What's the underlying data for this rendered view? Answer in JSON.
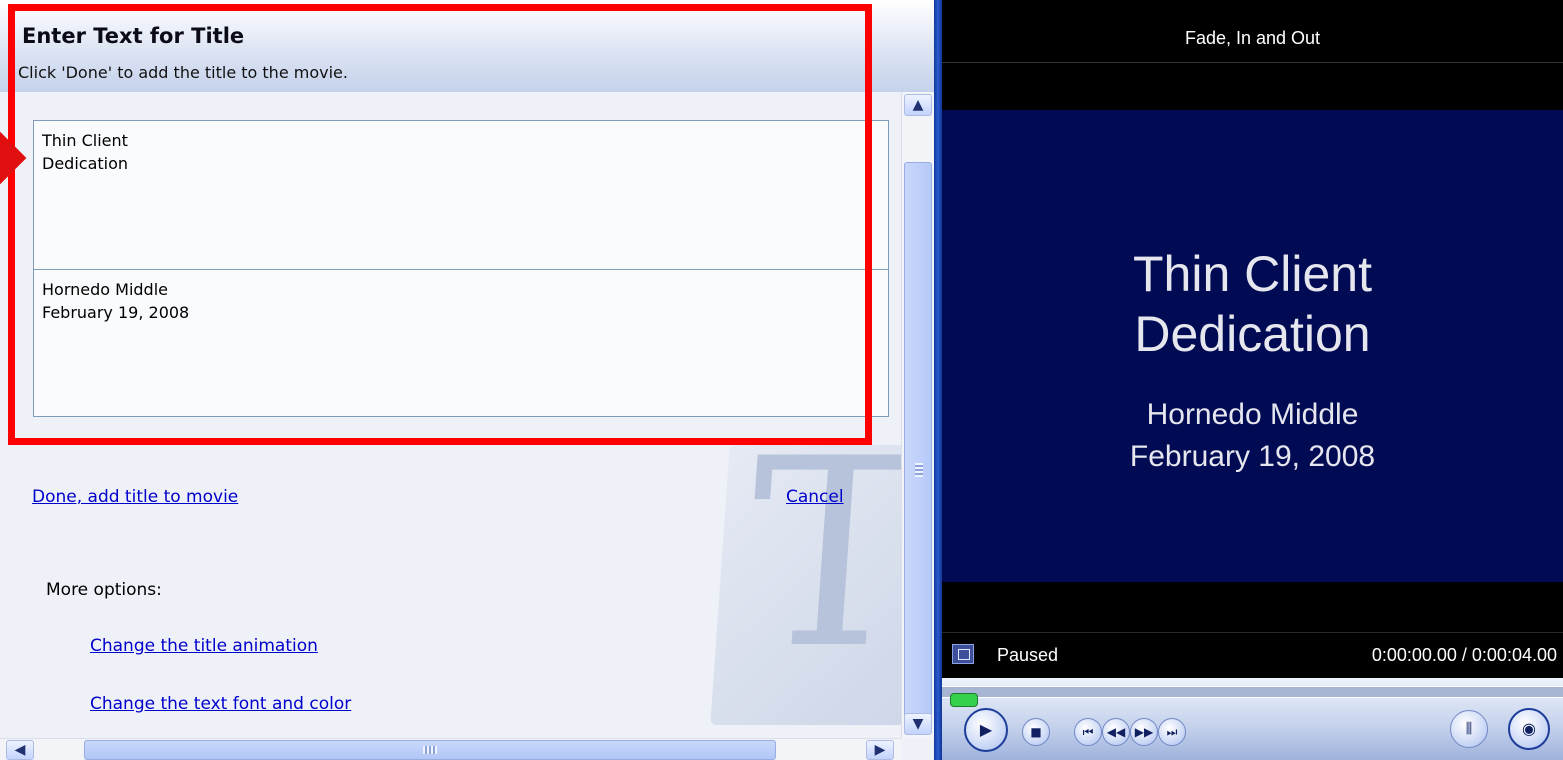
{
  "title_panel": {
    "heading": "Enter Text for Title",
    "instruction": "Click 'Done' to add the title to the movie.",
    "title_text": {
      "line1": "Thin Client",
      "line2": "Dedication"
    },
    "subtitle_text": {
      "line1": "Hornedo Middle",
      "line2": "February 19, 2008"
    },
    "done_link": "Done, add title to movie",
    "cancel_link": "Cancel",
    "more_options_label": "More options:",
    "animation_link": "Change the title animation",
    "font_link": "Change the text font and color",
    "watermark_letter": "T"
  },
  "preview": {
    "clip_name": "Fade, In and Out",
    "video_lines": [
      "Thin Client",
      "Dedication",
      "Hornedo Middle",
      "February 19, 2008"
    ],
    "status": "Paused",
    "time": "0:00:00.00 / 0:00:04.00",
    "playback_fraction": 0.0
  },
  "icons": {
    "play": "▶",
    "stop": "■",
    "previous": "⏮",
    "rewind": "◀◀",
    "fast_forward": "▶▶",
    "next": "⏭",
    "split": "split-icon",
    "snapshot": "camera-icon",
    "scroll_up": "▲",
    "scroll_down": "▼",
    "scroll_left": "◀",
    "scroll_right": "▶"
  },
  "colors": {
    "highlight": "#ff0000",
    "link": "#0000cc",
    "video_background": "#000b53",
    "seek_thumb": "#35d14d"
  }
}
